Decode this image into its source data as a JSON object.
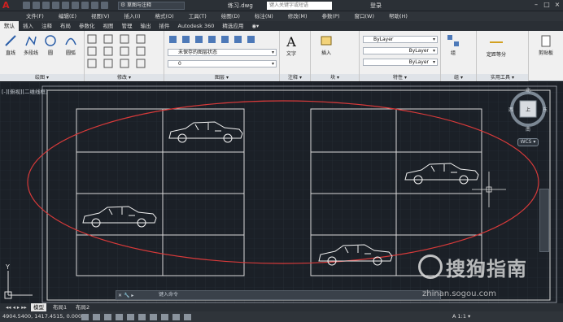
{
  "app": {
    "title": "练习.dwg",
    "workspace": "草图与注释",
    "search_placeholder": "键入关键字或短语",
    "login": "登录",
    "window_buttons": [
      "–",
      "□",
      "×"
    ],
    "colors": {
      "accent": "#d02020",
      "drawing_bg": "#1b2027",
      "ribbon_bg": "#f0f0f0",
      "active_tab_bg": "#f0f0f0"
    }
  },
  "menubar": [
    "文件(F)",
    "编辑(E)",
    "视图(V)",
    "插入(I)",
    "格式(O)",
    "工具(T)",
    "绘图(D)",
    "标注(N)",
    "修改(M)",
    "参数(P)",
    "窗口(W)",
    "帮助(H)"
  ],
  "tabs": [
    "默认",
    "插入",
    "注释",
    "布局",
    "参数化",
    "视图",
    "管理",
    "输出",
    "插件",
    "Autodesk 360",
    "精选应用",
    "◉▾"
  ],
  "ribbon": {
    "draw": {
      "title": "绘图 ▾",
      "line": "直线",
      "polyline": "多段线",
      "circle": "圆",
      "arc": "圆弧"
    },
    "modify": {
      "title": "修改 ▾"
    },
    "layers": {
      "title": "图层 ▾",
      "state": "未保存的图层状态",
      "layer": "0"
    },
    "annotation": {
      "title": "注释 ▾",
      "text": "文字"
    },
    "block": {
      "title": "块 ▾",
      "insert": "插入"
    },
    "properties": {
      "title": "特性 ▾",
      "color": "ByLayer",
      "linetype": "ByLayer",
      "lineweight": "ByLayer"
    },
    "groups": {
      "title": "组 ▾",
      "group": "组"
    },
    "utilities": {
      "title": "实用工具 ▾",
      "measure": "定距等分"
    },
    "clipboard": {
      "paste": "剪贴板"
    }
  },
  "drawing": {
    "viewport_label": "[-][俯视][二维线框]",
    "viewcube": {
      "north": "北",
      "south": "南",
      "east": "东",
      "west": "西",
      "top": "上"
    },
    "ucs_label": "WCS ▾",
    "y_axis": "Y"
  },
  "command": {
    "placeholder": "键入命令"
  },
  "layout_tabs": [
    "模型",
    "布局1",
    "布局2"
  ],
  "status": {
    "coords": "4904.5400, 1417.4515, 0.0000",
    "scale": "A 1:1 ▾"
  },
  "watermark": {
    "main": "搜狗指南",
    "sub": "zhinan.sogou.com"
  }
}
